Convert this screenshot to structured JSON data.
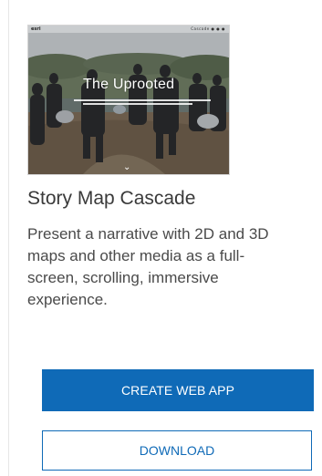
{
  "card": {
    "thumbnail": {
      "logo": "esri",
      "toolbar": "Cascade ● ● ●",
      "title": "The Uprooted",
      "chevron": "⌄",
      "colors": {
        "sky": "#dfe5e8",
        "ground": "#7b6a55",
        "trees": "#6f7f63"
      }
    },
    "title": "Story Map Cascade",
    "description_lines": [
      "Present a narrative with 2D and 3D",
      "maps and other media as a full-",
      "screen, scrolling, immersive",
      "experience."
    ],
    "buttons": {
      "create": "CREATE WEB APP",
      "download": "DOWNLOAD"
    },
    "colors": {
      "accent": "#0f6ab7",
      "title_text": "#3a3a3a",
      "body_text": "#4a4a4a"
    }
  }
}
